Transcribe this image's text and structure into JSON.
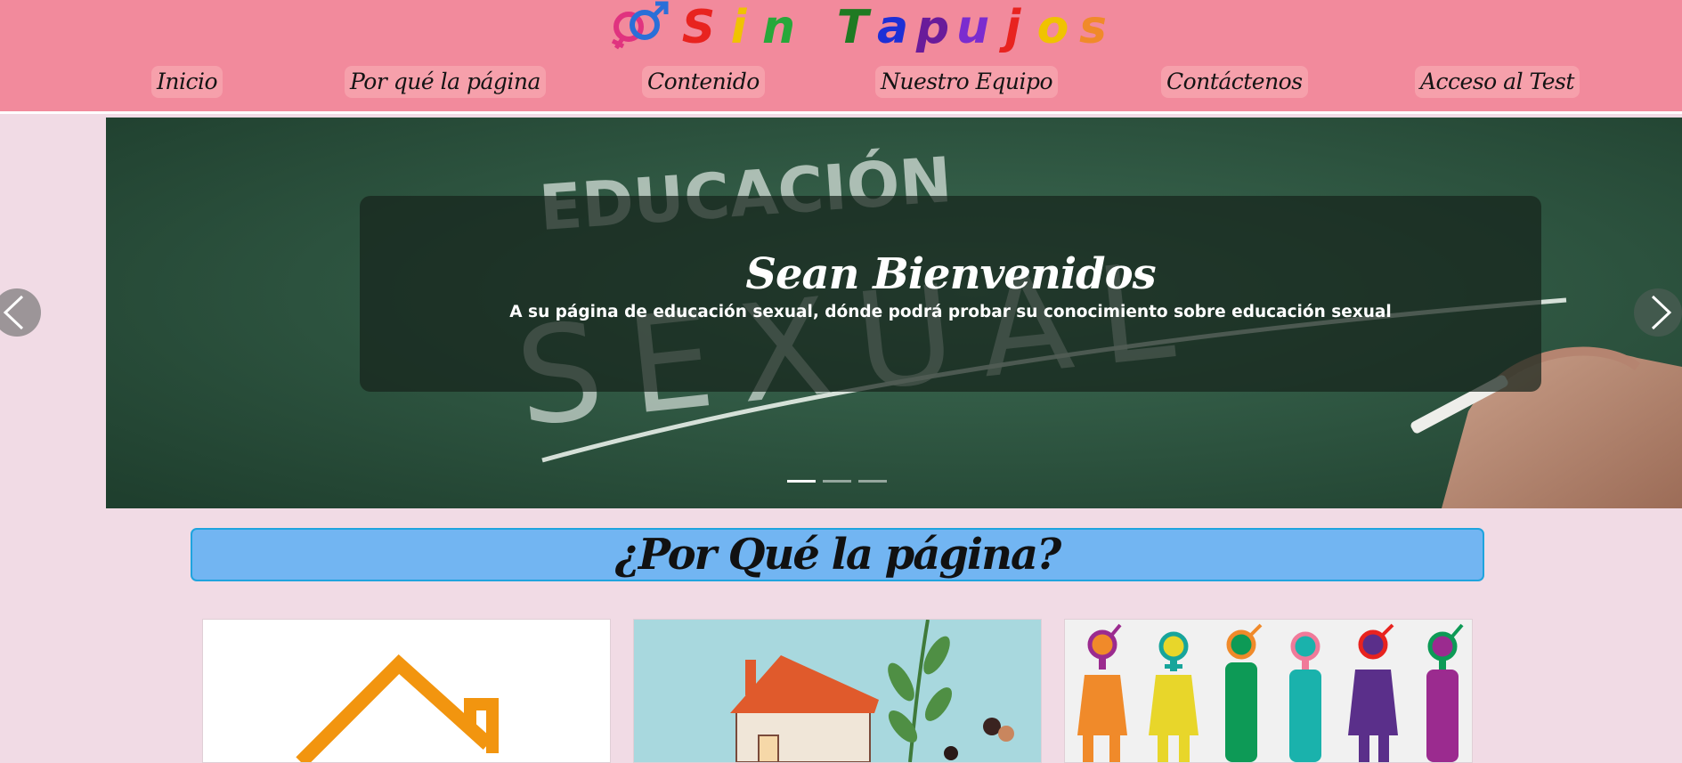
{
  "header": {
    "brand": {
      "letters": [
        {
          "char": "S",
          "color": "#e8231f"
        },
        {
          "char": "i",
          "color": "#f0c300"
        },
        {
          "char": "n",
          "color": "#27a83a"
        },
        {
          "char": "T",
          "color": "#1f7a22"
        },
        {
          "char": "a",
          "color": "#1d2fd6"
        },
        {
          "char": "p",
          "color": "#6a1b9a"
        },
        {
          "char": "u",
          "color": "#7b2ccf"
        },
        {
          "char": "j",
          "color": "#e8231f"
        },
        {
          "char": "o",
          "color": "#f0c300"
        },
        {
          "char": "s",
          "color": "#f08a2a"
        }
      ],
      "icon": "gender-symbols-icon"
    },
    "nav": [
      {
        "label": "Inicio"
      },
      {
        "label": "Por qué la página"
      },
      {
        "label": "Contenido"
      },
      {
        "label": "Nuestro Equipo"
      },
      {
        "label": "Contáctenos"
      },
      {
        "label": "Acceso al Test"
      }
    ]
  },
  "carousel": {
    "image": "chalkboard-educacion-sexual-image",
    "image_text": [
      "EDUCACIÓN",
      "SEXUAL"
    ],
    "title": "Sean Bienvenidos",
    "subtitle": "A su página de educación sexual, dónde podrá probar su conocimiento sobre educación sexual",
    "indicators": 3,
    "active_indicator": 0,
    "prev_icon": "chevron-left-icon",
    "next_icon": "chevron-right-icon"
  },
  "section": {
    "title": "¿Por Qué la página?"
  },
  "cards": [
    {
      "image": "house-outline-image"
    },
    {
      "image": "house-family-plant-image"
    },
    {
      "image": "gender-diversity-figures-image"
    }
  ],
  "colors": {
    "header_bg": "#f28a9c",
    "page_bg": "#f1dbe5",
    "section_bg": "#72b5f2",
    "section_border": "#1fa4de",
    "chalkboard": "#2f5a44"
  }
}
